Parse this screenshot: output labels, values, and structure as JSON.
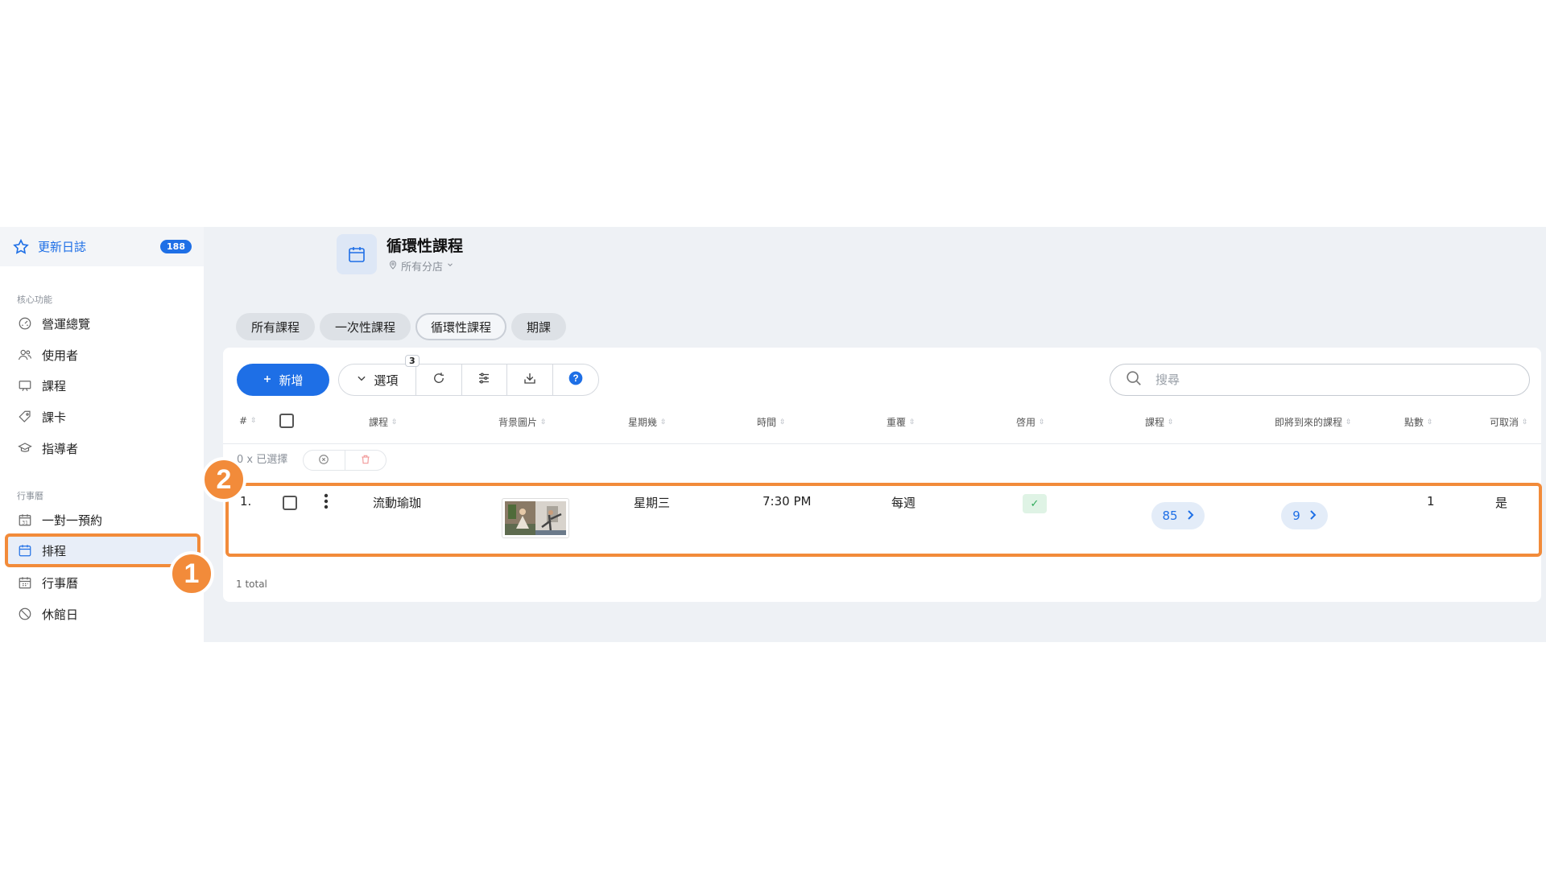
{
  "sidebar": {
    "changelog": {
      "label": "更新日誌",
      "badge": "188"
    },
    "sections": [
      {
        "title": "核心功能",
        "items": [
          {
            "label": "營運總覽",
            "icon": "gauge-icon"
          },
          {
            "label": "使用者",
            "icon": "users-icon"
          },
          {
            "label": "課程",
            "icon": "monitor-icon"
          },
          {
            "label": "課卡",
            "icon": "tag-icon"
          },
          {
            "label": "指導者",
            "icon": "graduation-cap-icon"
          }
        ]
      },
      {
        "title": "行事曆",
        "items": [
          {
            "label": "一對一預約",
            "icon": "calendar-31-icon"
          },
          {
            "label": "排程",
            "icon": "calendar-icon",
            "active": true
          },
          {
            "label": "行事曆",
            "icon": "calendar-grid-icon"
          },
          {
            "label": "休館日",
            "icon": "block-icon"
          }
        ]
      }
    ]
  },
  "callouts": {
    "first": "1",
    "second": "2"
  },
  "header": {
    "title": "循環性課程",
    "location": "所有分店"
  },
  "tabs": [
    {
      "label": "所有課程"
    },
    {
      "label": "一次性課程"
    },
    {
      "label": "循環性課程",
      "active": true
    },
    {
      "label": "期課"
    }
  ],
  "toolbar": {
    "add_label": "新增",
    "options_label": "選項",
    "options_count": "3",
    "search_placeholder": "搜尋"
  },
  "table": {
    "columns": [
      "#",
      "課程",
      "背景圖片",
      "星期幾",
      "時間",
      "重覆",
      "啓用",
      "課程",
      "即將到來的課程",
      "點數",
      "可取消"
    ],
    "selection_text": "0 x 已選擇",
    "rows": [
      {
        "index": "1.",
        "course": "流動瑜珈",
        "weekday": "星期三",
        "time": "7:30 PM",
        "repeat": "每週",
        "enabled": true,
        "course_count": "85",
        "upcoming": "9",
        "points": "1",
        "cancellable": "是"
      }
    ],
    "total": "1 total"
  },
  "colors": {
    "accent": "#1e6fe6",
    "callout": "#f28b3a",
    "enabled": "#2faa5a"
  }
}
